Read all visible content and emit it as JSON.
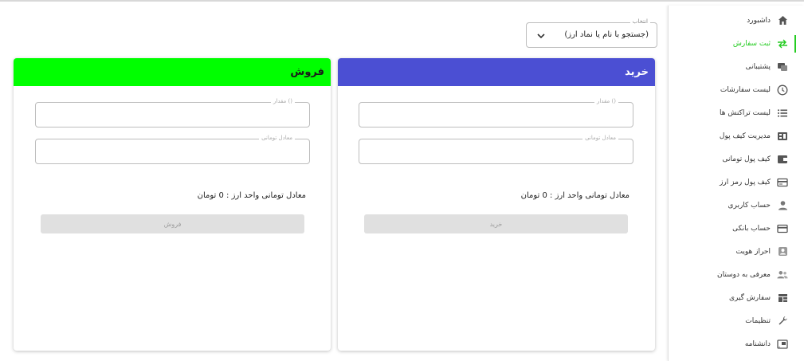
{
  "sidebar": {
    "items": [
      {
        "label": "داشبورد",
        "icon": "home-icon",
        "active": false
      },
      {
        "label": "ثبت سفارش",
        "icon": "exchange-icon",
        "active": true
      },
      {
        "label": "پشتیبانی",
        "icon": "support-icon",
        "active": false
      },
      {
        "label": "لیست سفارشات",
        "icon": "clock-icon",
        "active": false
      },
      {
        "label": "لیست تراکنش ها",
        "icon": "list-icon",
        "active": false
      },
      {
        "label": "مدیریت کیف پول",
        "icon": "wallet-manage-icon",
        "active": false
      },
      {
        "label": "کیف پول تومانی",
        "icon": "wallet-icon",
        "active": false
      },
      {
        "label": "کیف پول رمز ارز",
        "icon": "crypto-wallet-icon",
        "active": false
      },
      {
        "label": "حساب کاربری",
        "icon": "user-icon",
        "active": false
      },
      {
        "label": "حساب بانکی",
        "icon": "bank-card-icon",
        "active": false
      },
      {
        "label": "احراز هویت",
        "icon": "id-badge-icon",
        "active": false
      },
      {
        "label": "معرفی به دوستان",
        "icon": "referral-icon",
        "active": false
      },
      {
        "label": "سفارش گیری",
        "icon": "grid-icon",
        "active": false
      },
      {
        "label": "تنظیمات",
        "icon": "wrench-icon",
        "active": false
      },
      {
        "label": "دانشنامه",
        "icon": "cast-icon",
        "active": false
      }
    ],
    "accent": "#25cc22"
  },
  "currency_select": {
    "legend": "انتخاب",
    "value": "(جستجو با نام یا نماد ارز)"
  },
  "buy": {
    "title": "خرید",
    "amount_label": "مقدار ()",
    "toman_label": "معادل تومانی",
    "equivalent": "معادل تومانی واحد ارز : 0 تومان",
    "button": "خرید",
    "color": "#4b4fd3"
  },
  "sell": {
    "title": "فروش",
    "amount_label": "مقدار ()",
    "toman_label": "معادل تومانی",
    "equivalent": "معادل تومانی واحد ارز : 0 تومان",
    "button": "فروش",
    "color": "#00ff00"
  }
}
